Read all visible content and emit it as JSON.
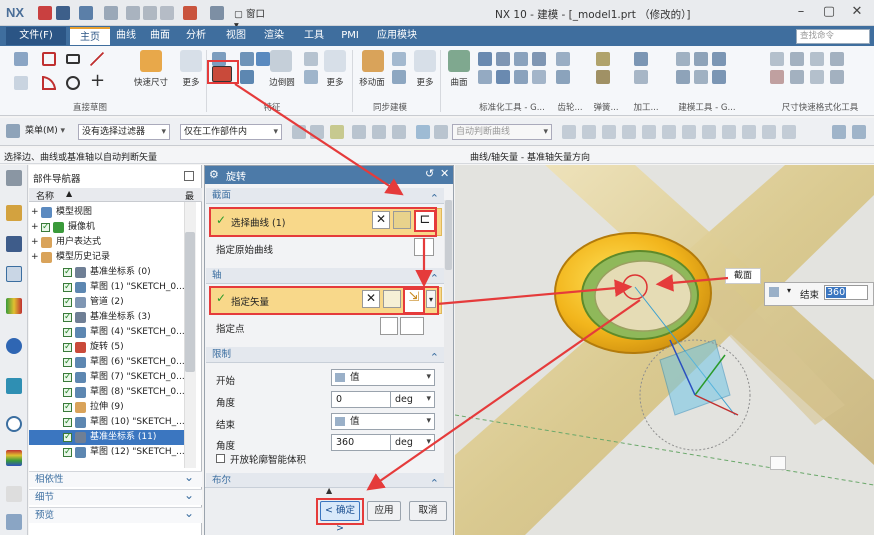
{
  "app": {
    "logo": "NX",
    "window_title": "NX 10 - 建模 - [_model1.prt （修改的）]"
  },
  "menu": {
    "file": "文件(F)",
    "tabs": [
      "主页",
      "曲线",
      "曲面",
      "分析",
      "视图",
      "渲染",
      "工具",
      "PMI",
      "应用模块"
    ],
    "search_placeholder": "查找命令"
  },
  "ribbon": {
    "groups": [
      {
        "label": "直接草图"
      },
      {
        "label": "特征"
      },
      {
        "label": "同步建模"
      },
      {
        "label": "标准化工具 - G..."
      },
      {
        "label": "齿轮..."
      },
      {
        "label": "弹簧..."
      },
      {
        "label": "加工..."
      },
      {
        "label": "建模工具 - G..."
      },
      {
        "label": "尺寸快速格式化工具"
      }
    ],
    "big_buttons": {
      "quick_dim": "快速尺寸",
      "more1": "更多",
      "edge_blend": "边倒圆",
      "more2": "更多",
      "move_face": "移动面",
      "more3": "更多",
      "surface": "曲面"
    }
  },
  "toolbar": {
    "menu": "菜单(M)",
    "filter": "没有选择过滤器",
    "scope": "仅在工作部件内",
    "snap": "自动判断曲线"
  },
  "status": {
    "left": "选择边、曲线或基准轴以自动判断矢量",
    "right": "曲线/轴矢量 - 基准轴矢量方向"
  },
  "navigator": {
    "title": "部件导航器",
    "col_name": "名称",
    "col_recent": "最",
    "rows": [
      {
        "label": "模型视图",
        "indent": 1,
        "check": false
      },
      {
        "label": "摄像机",
        "indent": 1,
        "check": true
      },
      {
        "label": "用户表达式",
        "indent": 1,
        "check": false
      },
      {
        "label": "模型历史记录",
        "indent": 1,
        "check": false
      },
      {
        "label": "基准坐标系 (0)",
        "indent": 2,
        "check": true
      },
      {
        "label": "草图 (1) \"SKETCH_0...",
        "indent": 2,
        "check": true
      },
      {
        "label": "管道 (2)",
        "indent": 2,
        "check": true
      },
      {
        "label": "基准坐标系 (3)",
        "indent": 2,
        "check": true
      },
      {
        "label": "草图 (4) \"SKETCH_0...",
        "indent": 2,
        "check": true
      },
      {
        "label": "旋转 (5)",
        "indent": 2,
        "check": true
      },
      {
        "label": "草图 (6) \"SKETCH_0...",
        "indent": 2,
        "check": true
      },
      {
        "label": "草图 (7) \"SKETCH_0...",
        "indent": 2,
        "check": true
      },
      {
        "label": "草图 (8) \"SKETCH_0...",
        "indent": 2,
        "check": true
      },
      {
        "label": "拉伸 (9)",
        "indent": 2,
        "check": true
      },
      {
        "label": "草图 (10) \"SKETCH_...",
        "indent": 2,
        "check": true
      },
      {
        "label": "基准坐标系 (11)",
        "indent": 2,
        "check": true,
        "selected": true
      },
      {
        "label": "草图 (12) \"SKETCH_...",
        "indent": 2,
        "check": true
      }
    ],
    "sections": [
      "相依性",
      "细节",
      "预览"
    ]
  },
  "dialog": {
    "title": "旋转",
    "sec_section": "截面",
    "select_curve": "选择曲线 (1)",
    "specify_origin_curve": "指定原始曲线",
    "sec_axis": "轴",
    "specify_vector": "指定矢量",
    "specify_point": "指定点",
    "sec_limits": "限制",
    "start_label": "开始",
    "start_type": "值",
    "angle_label": "角度",
    "start_angle": "0",
    "unit": "deg",
    "end_label": "结束",
    "end_type": "值",
    "end_angle": "360",
    "open_profile": "开放轮廓智能体积",
    "sec_bool": "布尔",
    "ok": "< 确定 >",
    "apply": "应用",
    "cancel": "取消"
  },
  "viewport": {
    "callout_label": "截面",
    "end_label": "结束",
    "end_value": "360"
  }
}
